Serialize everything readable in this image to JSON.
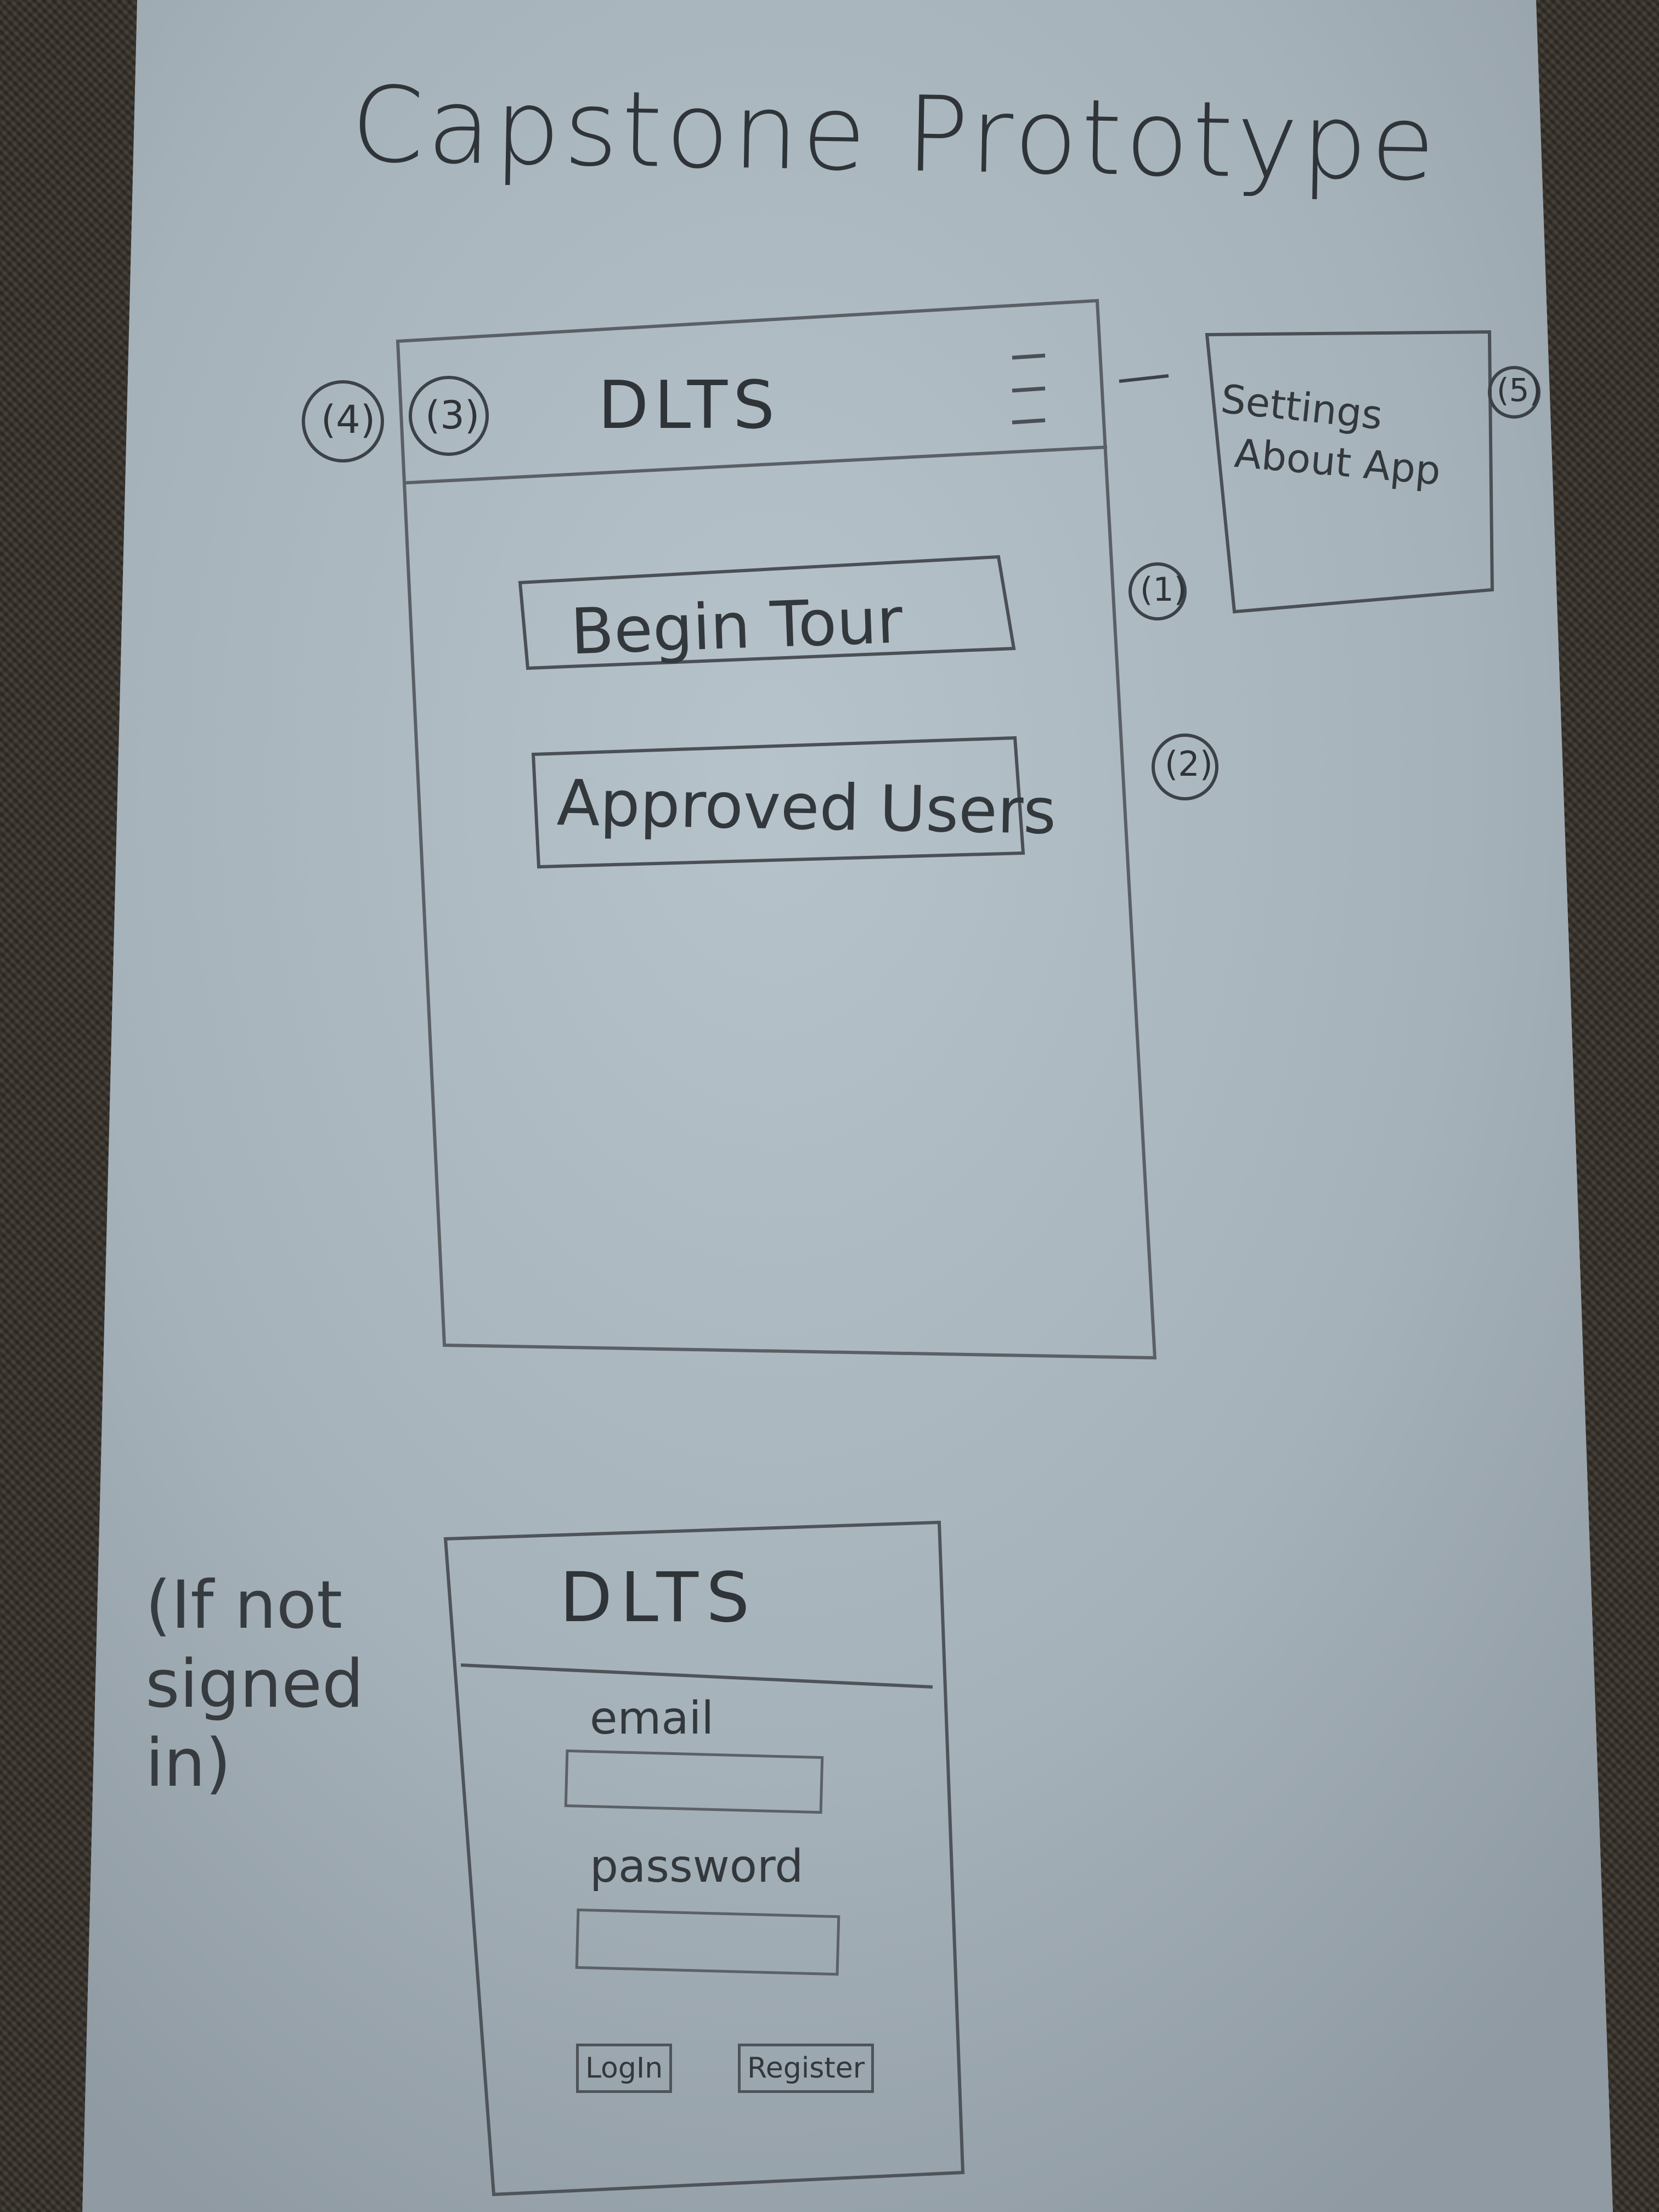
{
  "sketch": {
    "title": "Capstone Prototype"
  },
  "home_screen": {
    "header": {
      "profile_number": "(3)",
      "section_number": "(4)",
      "app_title": "DLTS",
      "menu_icon": "hamburger-menu-icon"
    },
    "buttons": [
      {
        "label": "Begin Tour",
        "number": "(1)"
      },
      {
        "label": "Approved Users",
        "number": "(2)"
      }
    ]
  },
  "menu_popup": {
    "number": "(5)",
    "items": [
      "Settings",
      "About App"
    ]
  },
  "login_screen": {
    "note": "(If not signed in)",
    "app_title": "DLTS",
    "email_label": "email",
    "password_label": "password",
    "login_label": "LogIn",
    "register_label": "Register"
  },
  "colors": {
    "paper": "#a9b5bd",
    "ink": "#2f3438",
    "background": "#3c362f"
  }
}
